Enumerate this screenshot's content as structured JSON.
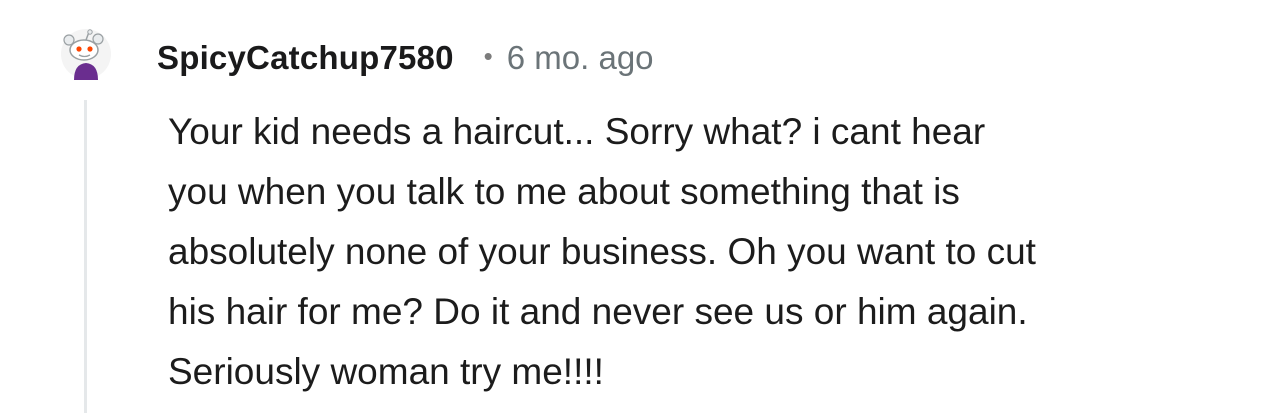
{
  "comment": {
    "author": "SpicyCatchup7580",
    "separator": "•",
    "age": "6 mo. ago",
    "avatar_icon": "snoo-avatar-icon",
    "body_lines": [
      "Your kid needs a haircut... Sorry what? i cant hear",
      "you when you talk to me about something that is",
      "absolutely none of your business. Oh you want to cut",
      "his hair for me? Do it and never see us or him again.",
      "Seriously woman try me!!!!"
    ]
  },
  "colors": {
    "username": "#1a1a1b",
    "meta": "#6b7478",
    "body": "#1c1c1c",
    "thread_line": "#e5e8ea",
    "avatar_accent": "#ff4500",
    "avatar_shirt": "#6a2d8f"
  }
}
